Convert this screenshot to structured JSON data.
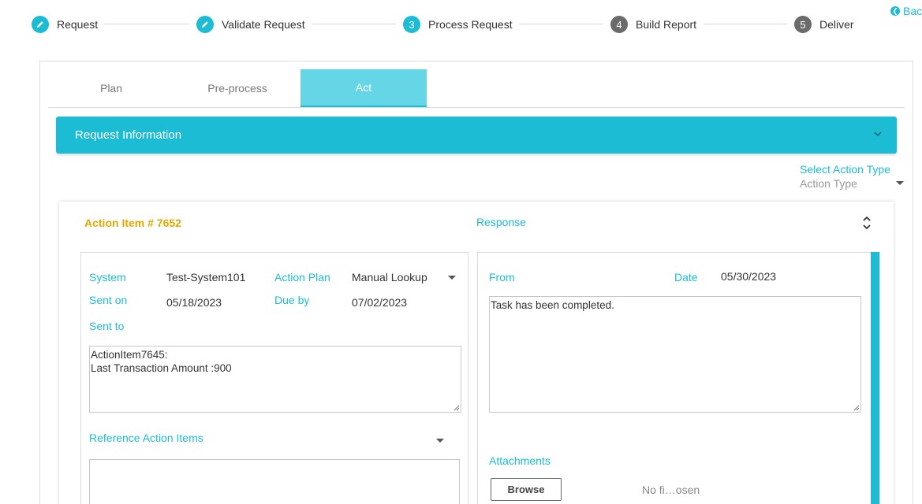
{
  "stepper": {
    "steps": [
      {
        "number": "",
        "label": "Request",
        "state": "done",
        "icon": "pencil-icon"
      },
      {
        "number": "",
        "label": "Validate Request",
        "state": "done",
        "icon": "pencil-icon"
      },
      {
        "number": "3",
        "label": "Process Request",
        "state": "current"
      },
      {
        "number": "4",
        "label": "Build Report",
        "state": "todo"
      },
      {
        "number": "5",
        "label": "Deliver",
        "state": "todo"
      }
    ]
  },
  "back": {
    "label": "Bac",
    "icon": "chevron-left-circle-icon"
  },
  "tabs": [
    {
      "label": "Plan",
      "active": false
    },
    {
      "label": "Pre-process",
      "active": false
    },
    {
      "label": "Act",
      "active": true
    }
  ],
  "request_info": {
    "title": "Request Information",
    "icon": "chevron-down-icon"
  },
  "action_type": {
    "label": "Select Action Type",
    "placeholder": "Action Type"
  },
  "action_item": {
    "title": "Action Item # 7652",
    "response_title": "Response",
    "left": {
      "system_label": "System",
      "system_value": "Test-System101",
      "action_plan_label": "Action Plan",
      "action_plan_value": "Manual Lookup",
      "sent_on_label": "Sent on",
      "sent_on_value": "05/18/2023",
      "due_by_label": "Due by",
      "due_by_value": "07/02/2023",
      "sent_to_label": "Sent to",
      "message_line1": "ActionItem7645:",
      "message_line2": "Last Transaction Amount :900",
      "reference_label": "Reference Action Items"
    },
    "right": {
      "from_label": "From",
      "date_label": "Date",
      "date_value": "05/30/2023",
      "response_text": "Task has been completed.",
      "attachments_label": "Attachments",
      "browse_label": "Browse",
      "no_file_label": "No fi…osen"
    }
  },
  "colors": {
    "accent": "#1cbcd4",
    "tab_active": "#65d6e6",
    "title_gold": "#e0a800",
    "step_todo": "#6b6b6b"
  }
}
